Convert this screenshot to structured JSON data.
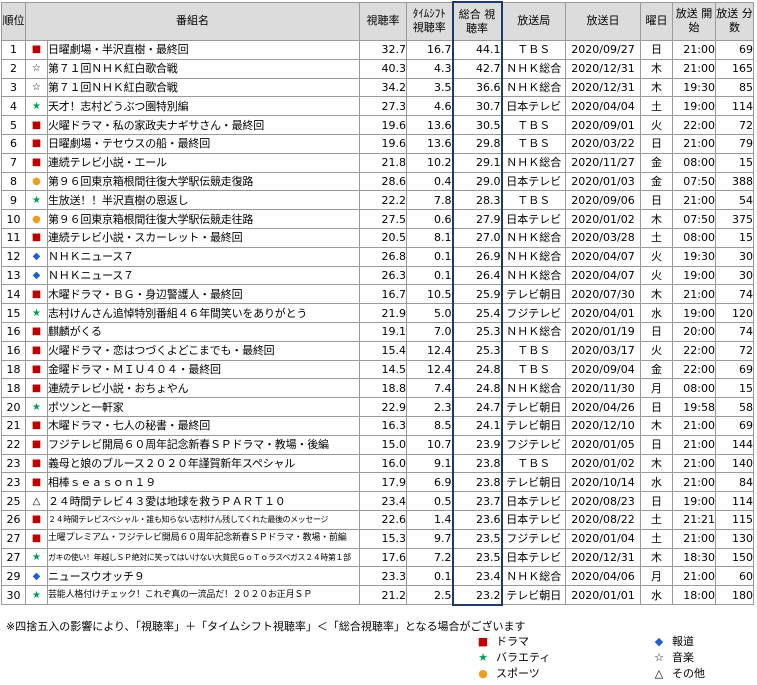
{
  "headers": {
    "rank": "順位",
    "title": "番組名",
    "rating": "視聴率",
    "timeshift": "ﾀｲﾑｼﾌﾄ 視聴率",
    "total": "総合 視聴率",
    "station": "放送局",
    "date": "放送日",
    "day": "曜日",
    "start": "放送 開始",
    "minutes": "放送 分数"
  },
  "genre_marks": {
    "drama": "■",
    "variety": "★",
    "sports": "●",
    "news": "◆",
    "music": "☆",
    "other": "△"
  },
  "genre_colors": {
    "drama": "#c00000",
    "variety": "#00a050",
    "sports": "#f0a020",
    "news": "#1f5fd0",
    "music": "#000000",
    "other": "#000000"
  },
  "rows": [
    {
      "rank": "1",
      "genre": "drama",
      "title": "日曜劇場・半沢直樹・最終回",
      "rating": "32.7",
      "ts": "16.7",
      "total": "44.1",
      "station": "ＴＢＳ",
      "date": "2020/09/27",
      "day": "日",
      "start": "21:00",
      "min": "69"
    },
    {
      "rank": "2",
      "genre": "music",
      "title": "第７１回ＮＨＫ紅白歌合戦",
      "rating": "40.3",
      "ts": "4.3",
      "total": "42.7",
      "station": "ＮＨＫ総合",
      "date": "2020/12/31",
      "day": "木",
      "start": "21:00",
      "min": "165"
    },
    {
      "rank": "3",
      "genre": "music",
      "title": "第７１回ＮＨＫ紅白歌合戦",
      "rating": "34.2",
      "ts": "3.5",
      "total": "36.6",
      "station": "ＮＨＫ総合",
      "date": "2020/12/31",
      "day": "木",
      "start": "19:30",
      "min": "85"
    },
    {
      "rank": "4",
      "genre": "variety",
      "title": "天才！志村どうぶつ園特別編",
      "rating": "27.3",
      "ts": "4.6",
      "total": "30.7",
      "station": "日本テレビ",
      "date": "2020/04/04",
      "day": "土",
      "start": "19:00",
      "min": "114"
    },
    {
      "rank": "5",
      "genre": "drama",
      "title": "火曜ドラマ・私の家政夫ナギサさん・最終回",
      "rating": "19.6",
      "ts": "13.6",
      "total": "30.5",
      "station": "ＴＢＳ",
      "date": "2020/09/01",
      "day": "火",
      "start": "22:00",
      "min": "72"
    },
    {
      "rank": "6",
      "genre": "drama",
      "title": "日曜劇場・テセウスの船・最終回",
      "rating": "19.6",
      "ts": "13.6",
      "total": "29.8",
      "station": "ＴＢＳ",
      "date": "2020/03/22",
      "day": "日",
      "start": "21:00",
      "min": "79"
    },
    {
      "rank": "7",
      "genre": "drama",
      "title": "連続テレビ小説・エール",
      "rating": "21.8",
      "ts": "10.2",
      "total": "29.1",
      "station": "ＮＨＫ総合",
      "date": "2020/11/27",
      "day": "金",
      "start": "08:00",
      "min": "15"
    },
    {
      "rank": "8",
      "genre": "sports",
      "title": "第９６回東京箱根間往復大学駅伝競走復路",
      "rating": "28.6",
      "ts": "0.4",
      "total": "29.0",
      "station": "日本テレビ",
      "date": "2020/01/03",
      "day": "金",
      "start": "07:50",
      "min": "388"
    },
    {
      "rank": "9",
      "genre": "variety",
      "title": "生放送！！半沢直樹の恩返し",
      "rating": "22.2",
      "ts": "7.8",
      "total": "28.3",
      "station": "ＴＢＳ",
      "date": "2020/09/06",
      "day": "日",
      "start": "21:00",
      "min": "54"
    },
    {
      "rank": "10",
      "genre": "sports",
      "title": "第９６回東京箱根間往復大学駅伝競走往路",
      "rating": "27.5",
      "ts": "0.6",
      "total": "27.9",
      "station": "日本テレビ",
      "date": "2020/01/02",
      "day": "木",
      "start": "07:50",
      "min": "375"
    },
    {
      "rank": "11",
      "genre": "drama",
      "title": "連続テレビ小説・スカーレット・最終回",
      "rating": "20.5",
      "ts": "8.1",
      "total": "27.0",
      "station": "ＮＨＫ総合",
      "date": "2020/03/28",
      "day": "土",
      "start": "08:00",
      "min": "15"
    },
    {
      "rank": "12",
      "genre": "news",
      "title": "ＮＨＫニュース７",
      "rating": "26.8",
      "ts": "0.1",
      "total": "26.9",
      "station": "ＮＨＫ総合",
      "date": "2020/04/07",
      "day": "火",
      "start": "19:30",
      "min": "30"
    },
    {
      "rank": "13",
      "genre": "news",
      "title": "ＮＨＫニュース７",
      "rating": "26.3",
      "ts": "0.1",
      "total": "26.4",
      "station": "ＮＨＫ総合",
      "date": "2020/04/07",
      "day": "火",
      "start": "19:00",
      "min": "30"
    },
    {
      "rank": "14",
      "genre": "drama",
      "title": "木曜ドラマ・ＢＧ・身辺警護人・最終回",
      "rating": "16.7",
      "ts": "10.5",
      "total": "25.9",
      "station": "テレビ朝日",
      "date": "2020/07/30",
      "day": "木",
      "start": "21:00",
      "min": "74"
    },
    {
      "rank": "15",
      "genre": "variety",
      "title": "志村けんさん追悼特別番組４６年間笑いをありがとう",
      "rating": "21.9",
      "ts": "5.0",
      "total": "25.4",
      "station": "フジテレビ",
      "date": "2020/04/01",
      "day": "水",
      "start": "19:00",
      "min": "120"
    },
    {
      "rank": "16",
      "genre": "drama",
      "title": "麒麟がくる",
      "rating": "19.1",
      "ts": "7.0",
      "total": "25.3",
      "station": "ＮＨＫ総合",
      "date": "2020/01/19",
      "day": "日",
      "start": "20:00",
      "min": "74"
    },
    {
      "rank": "16",
      "genre": "drama",
      "title": "火曜ドラマ・恋はつづくよどこまでも・最終回",
      "rating": "15.4",
      "ts": "12.4",
      "total": "25.3",
      "station": "ＴＢＳ",
      "date": "2020/03/17",
      "day": "火",
      "start": "22:00",
      "min": "72"
    },
    {
      "rank": "18",
      "genre": "drama",
      "title": "金曜ドラマ・ＭＩＵ４０４・最終回",
      "rating": "14.5",
      "ts": "12.4",
      "total": "24.8",
      "station": "ＴＢＳ",
      "date": "2020/09/04",
      "day": "金",
      "start": "22:00",
      "min": "69"
    },
    {
      "rank": "18",
      "genre": "drama",
      "title": "連続テレビ小説・おちょやん",
      "rating": "18.8",
      "ts": "7.4",
      "total": "24.8",
      "station": "ＮＨＫ総合",
      "date": "2020/11/30",
      "day": "月",
      "start": "08:00",
      "min": "15"
    },
    {
      "rank": "20",
      "genre": "variety",
      "title": "ポツンと一軒家",
      "rating": "22.9",
      "ts": "2.3",
      "total": "24.7",
      "station": "テレビ朝日",
      "date": "2020/04/26",
      "day": "日",
      "start": "19:58",
      "min": "58"
    },
    {
      "rank": "21",
      "genre": "drama",
      "title": "木曜ドラマ・七人の秘書・最終回",
      "rating": "16.3",
      "ts": "8.5",
      "total": "24.1",
      "station": "テレビ朝日",
      "date": "2020/12/10",
      "day": "木",
      "start": "21:00",
      "min": "69"
    },
    {
      "rank": "22",
      "genre": "drama",
      "title": "フジテレビ開局６０周年記念新春ＳＰドラマ・教場・後編",
      "rating": "15.0",
      "ts": "10.7",
      "total": "23.9",
      "station": "フジテレビ",
      "date": "2020/01/05",
      "day": "日",
      "start": "21:00",
      "min": "144"
    },
    {
      "rank": "23",
      "genre": "drama",
      "title": "義母と娘のブルース２０２０年謹賀新年スペシャル",
      "rating": "16.0",
      "ts": "9.1",
      "total": "23.8",
      "station": "ＴＢＳ",
      "date": "2020/01/02",
      "day": "木",
      "start": "21:00",
      "min": "140"
    },
    {
      "rank": "23",
      "genre": "drama",
      "title": "相棒ｓｅａｓｏｎ１９",
      "rating": "17.9",
      "ts": "6.9",
      "total": "23.8",
      "station": "テレビ朝日",
      "date": "2020/10/14",
      "day": "水",
      "start": "21:00",
      "min": "84"
    },
    {
      "rank": "25",
      "genre": "other",
      "title": "２４時間テレビ４３愛は地球を救うＰＡＲＴ１０",
      "rating": "23.4",
      "ts": "0.5",
      "total": "23.7",
      "station": "日本テレビ",
      "date": "2020/08/23",
      "day": "日",
      "start": "19:00",
      "min": "114"
    },
    {
      "rank": "26",
      "genre": "drama",
      "title": "２４時間テレビスペシャル・誰も知らない志村けん残してくれた最後のメッセージ",
      "rating": "22.6",
      "ts": "1.4",
      "total": "23.6",
      "station": "日本テレビ",
      "date": "2020/08/22",
      "day": "土",
      "start": "21:21",
      "min": "115"
    },
    {
      "rank": "27",
      "genre": "drama",
      "title": "土曜プレミアム・フジテレビ開局６０周年記念新春ＳＰドラマ・教場・前編",
      "rating": "15.3",
      "ts": "9.7",
      "total": "23.5",
      "station": "フジテレビ",
      "date": "2020/01/04",
      "day": "土",
      "start": "21:00",
      "min": "130"
    },
    {
      "rank": "27",
      "genre": "variety",
      "title": "ガキの使い！年越しＳＰ絶対に笑ってはいけない大貧民ＧｏＴｏラスベガス２４時第１部",
      "rating": "17.6",
      "ts": "7.2",
      "total": "23.5",
      "station": "日本テレビ",
      "date": "2020/12/31",
      "day": "木",
      "start": "18:30",
      "min": "150"
    },
    {
      "rank": "29",
      "genre": "news",
      "title": "ニュースウオッチ９",
      "rating": "23.3",
      "ts": "0.1",
      "total": "23.4",
      "station": "ＮＨＫ総合",
      "date": "2020/04/06",
      "day": "月",
      "start": "21:00",
      "min": "60"
    },
    {
      "rank": "30",
      "genre": "variety",
      "title": "芸能人格付けチェック！これぞ真の一流品だ！２０２０お正月ＳＰ",
      "rating": "21.2",
      "ts": "2.5",
      "total": "23.2",
      "station": "テレビ朝日",
      "date": "2020/01/01",
      "day": "水",
      "start": "18:00",
      "min": "180"
    }
  ],
  "note": "※四捨五入の影響により、「視聴率」＋「タイムシフト視聴率」＜「総合視聴率」となる場合がございます",
  "legend": [
    {
      "key": "drama",
      "label": "ドラマ"
    },
    {
      "key": "variety",
      "label": "バラエティ"
    },
    {
      "key": "sports",
      "label": "スポーツ"
    },
    {
      "key": "news",
      "label": "報道"
    },
    {
      "key": "music",
      "label": "音楽"
    },
    {
      "key": "other",
      "label": "その他"
    }
  ]
}
